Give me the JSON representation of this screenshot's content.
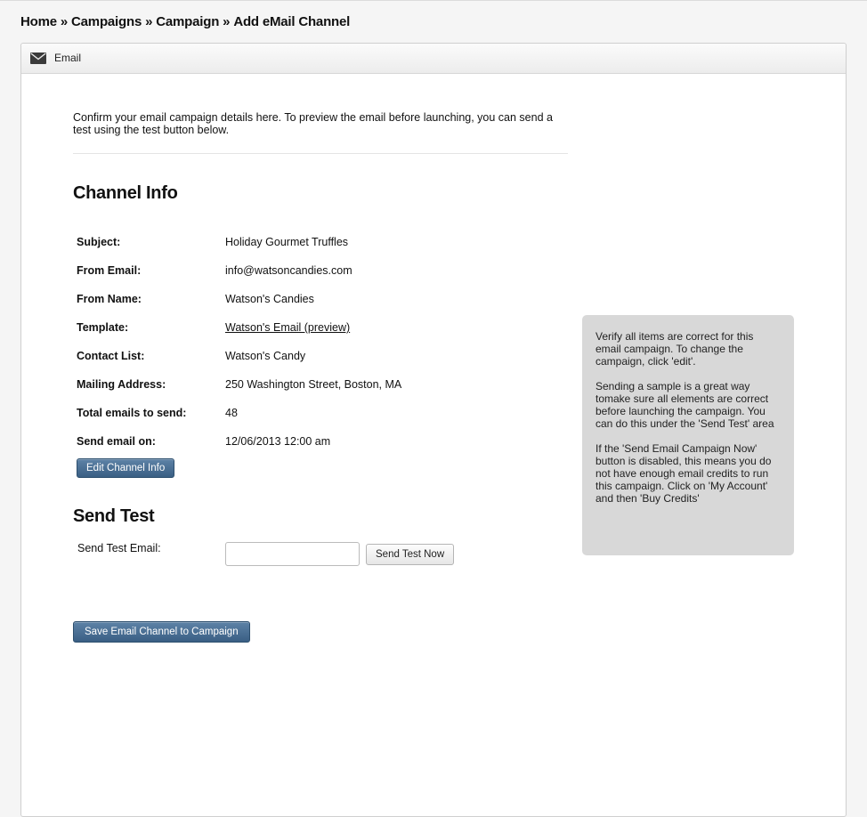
{
  "breadcrumb": {
    "items": [
      "Home",
      "Campaigns",
      "Campaign",
      "Add eMail Channel"
    ],
    "separator": "»"
  },
  "panel": {
    "icon": "envelope-icon",
    "title": "Email"
  },
  "intro_text": "Confirm your email campaign details here. To preview the email before launching, you can send a test using the test button below.",
  "channel_info": {
    "heading": "Channel Info",
    "rows": [
      {
        "label": "Subject:",
        "value": "Holiday Gourmet Truffles"
      },
      {
        "label": "From Email:",
        "value": "info@watsoncandies.com"
      },
      {
        "label": "From Name:",
        "value": "Watson's Candies"
      },
      {
        "label": "Template:",
        "value": "Watson's Email (preview)"
      },
      {
        "label": "Contact List:",
        "value": "Watson's Candy"
      },
      {
        "label": "Mailing Address:",
        "value": "250 Washington Street, Boston, MA"
      },
      {
        "label": "Total emails to send:",
        "value": "48"
      },
      {
        "label": "Send email on:",
        "value": "12/06/2013 12:00 am"
      }
    ],
    "edit_button": "Edit Channel Info"
  },
  "send_test": {
    "heading": "Send Test",
    "label": "Send Test Email:",
    "input_value": "",
    "button": "Send Test Now"
  },
  "save_button": "Save Email Channel to Campaign",
  "help": {
    "paragraphs": [
      "Verify all items are correct for this email campaign. To change the campaign, click 'edit'.",
      "Sending a sample is a great way tomake sure all elements are correct before launching the campaign. You can do this under the 'Send Test' area",
      "If the 'Send Email Campaign Now' button is disabled, this means you do not have enough email credits to run this campaign. Click on 'My Account' and then 'Buy Credits'"
    ]
  },
  "colors": {
    "primary_button": "#3a5f84",
    "help_box": "#d8d8d8"
  }
}
